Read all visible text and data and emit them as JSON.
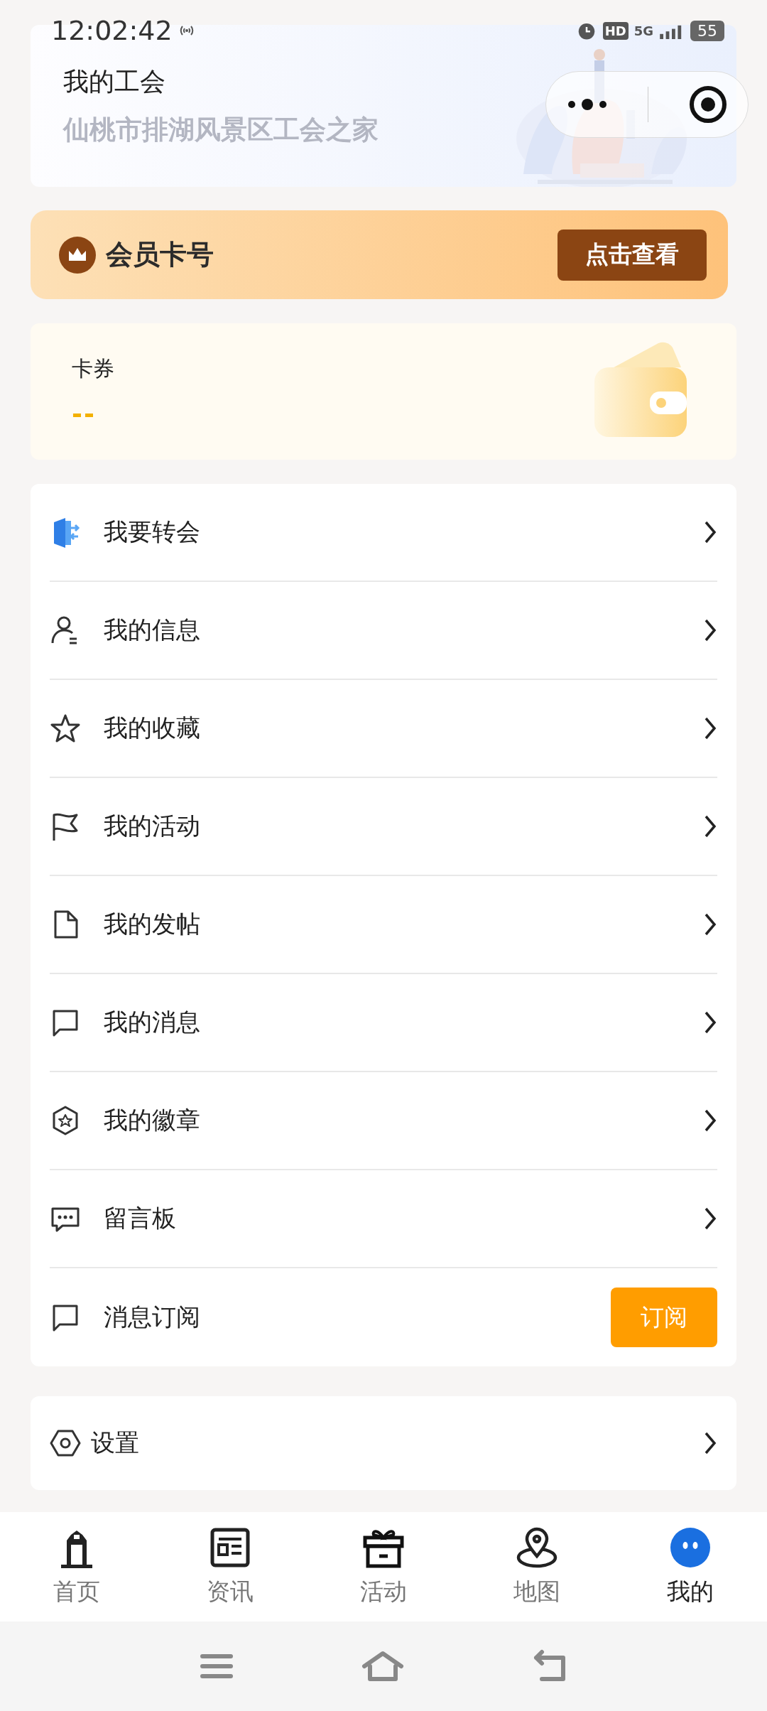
{
  "status_bar": {
    "time": "12:02:42",
    "hd": "HD",
    "network": "5G",
    "battery": "55"
  },
  "union": {
    "title": "我的工会",
    "name": "仙桃市排湖风景区工会之家"
  },
  "member_card": {
    "label": "会员卡号",
    "button": "点击查看"
  },
  "coupons": {
    "label": "卡券",
    "value": "--"
  },
  "menu": [
    {
      "kind": "link",
      "label": "我要转会"
    },
    {
      "kind": "link",
      "label": "我的信息"
    },
    {
      "kind": "link",
      "label": "我的收藏"
    },
    {
      "kind": "link",
      "label": "我的活动"
    },
    {
      "kind": "link",
      "label": "我的发帖"
    },
    {
      "kind": "link",
      "label": "我的消息"
    },
    {
      "kind": "link",
      "label": "我的徽章"
    },
    {
      "kind": "link",
      "label": "留言板"
    },
    {
      "kind": "action",
      "label": "消息订阅",
      "button": "订阅"
    }
  ],
  "settings": {
    "label": "设置"
  },
  "tabs": [
    {
      "label": "首页",
      "selected": false
    },
    {
      "label": "资讯",
      "selected": false
    },
    {
      "label": "活动",
      "selected": false
    },
    {
      "label": "地图",
      "selected": false
    },
    {
      "label": "我的",
      "selected": true
    }
  ]
}
